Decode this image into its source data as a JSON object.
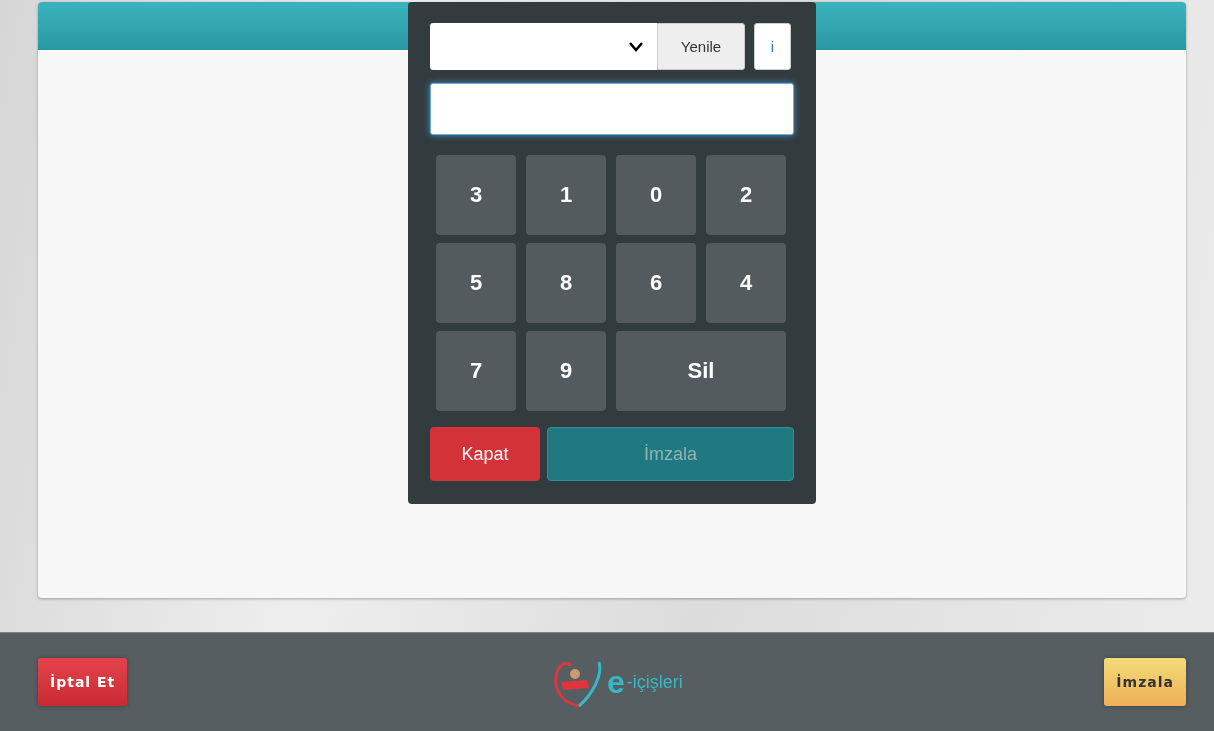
{
  "dialog": {
    "refresh_button": "Yenile",
    "info_button": "i",
    "keys": [
      {
        "label": "3",
        "kind": "digit"
      },
      {
        "label": "1",
        "kind": "digit"
      },
      {
        "label": "0",
        "kind": "digit"
      },
      {
        "label": "2",
        "kind": "digit"
      },
      {
        "label": "5",
        "kind": "digit"
      },
      {
        "label": "8",
        "kind": "digit"
      },
      {
        "label": "6",
        "kind": "digit"
      },
      {
        "label": "4",
        "kind": "digit"
      },
      {
        "label": "7",
        "kind": "digit"
      },
      {
        "label": "9",
        "kind": "digit"
      },
      {
        "label": "Sil",
        "kind": "delete"
      }
    ],
    "close_button": "Kapat",
    "sign_button": {
      "label": "İmzala",
      "disabled": true
    }
  },
  "footer": {
    "cancel_button": "İptal Et",
    "logo": {
      "mark": "e",
      "text": "-içişleri"
    },
    "sign_button": "İmzala"
  }
}
